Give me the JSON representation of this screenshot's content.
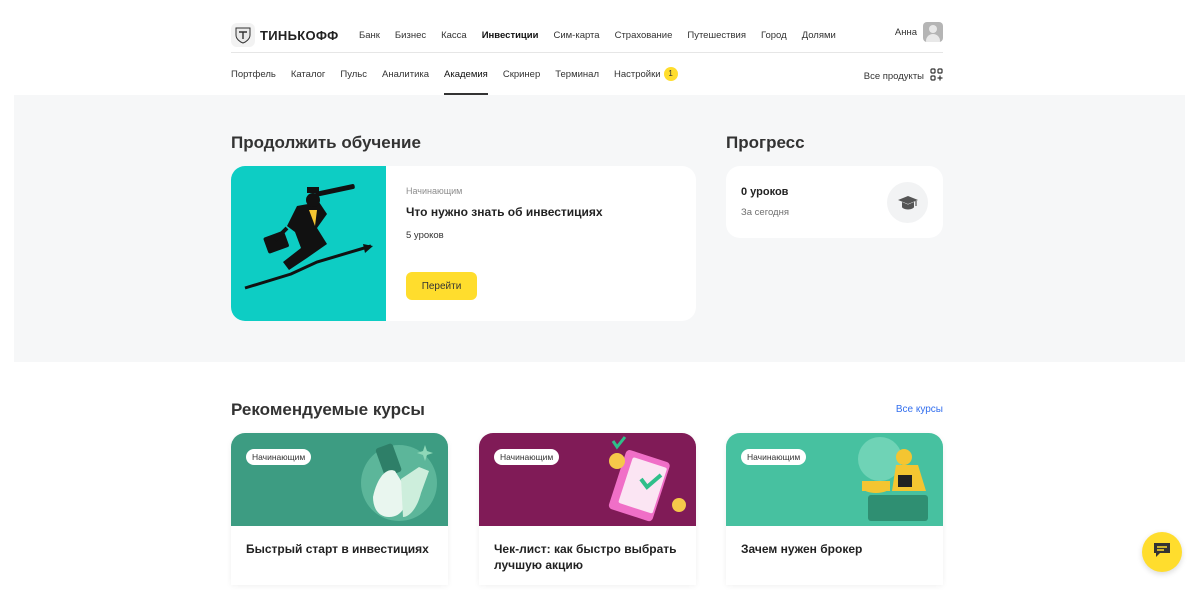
{
  "header": {
    "logo_text": "ТИНЬКОФФ",
    "nav": [
      "Банк",
      "Бизнес",
      "Касса",
      "Инвестиции",
      "Сим-карта",
      "Страхование",
      "Путешествия",
      "Город",
      "Долями"
    ],
    "active_nav": "Инвестиции",
    "user_name": "Анна"
  },
  "subnav": {
    "items": [
      "Портфель",
      "Каталог",
      "Пульс",
      "Аналитика",
      "Академия",
      "Скринер",
      "Терминал",
      "Настройки"
    ],
    "active": "Академия",
    "settings_badge": "1",
    "all_products": "Все продукты"
  },
  "continue": {
    "title": "Продолжить обучение",
    "level": "Начинающим",
    "course_name": "Что нужно знать об инвестициях",
    "lessons": "5 уроков",
    "button": "Перейти"
  },
  "progress": {
    "title": "Прогресс",
    "count": "0 уроков",
    "subtitle": "За сегодня"
  },
  "recommended": {
    "title": "Рекомендуемые курсы",
    "all_link": "Все курсы",
    "cards": [
      {
        "level": "Начинающим",
        "name": "Быстрый старт в инвестициях",
        "color": "#3d9c82"
      },
      {
        "level": "Начинающим",
        "name": "Чек-лист: как быстро выбрать лучшую акцию",
        "color": "#801b57"
      },
      {
        "level": "Начинающим",
        "name": "Зачем нужен брокер",
        "color": "#47c1a0"
      }
    ]
  },
  "colors": {
    "accent_yellow": "#ffdd2d",
    "link_blue": "#336fee",
    "teal": "#0dcdc4"
  },
  "icons": [
    "logo-shield-icon",
    "avatar",
    "grid-plus-icon",
    "graduation-cap-icon",
    "chat-icon"
  ]
}
